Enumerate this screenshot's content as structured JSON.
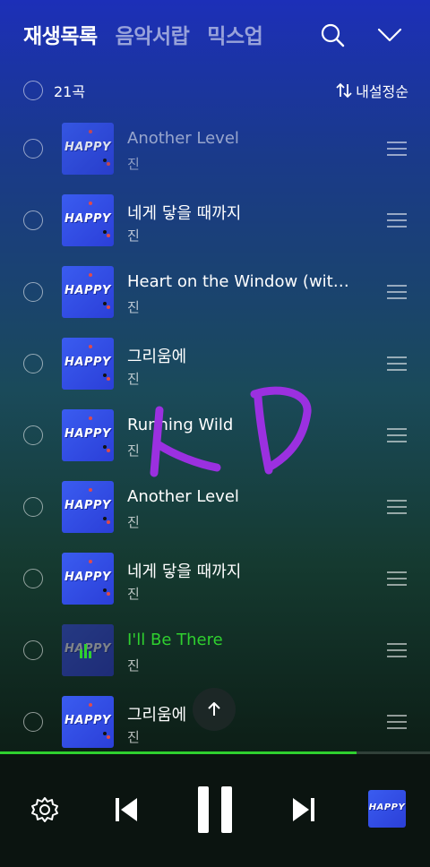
{
  "tabs": [
    {
      "label": "재생목록",
      "active": true
    },
    {
      "label": "음악서랍",
      "active": false
    },
    {
      "label": "믹스업",
      "active": false
    }
  ],
  "header_icons": [
    "search-icon",
    "chevron-down-icon"
  ],
  "list_header": {
    "count": "21곡",
    "sort_label": "내설정순"
  },
  "album_art_text": "HAPPY",
  "tracks": [
    {
      "title": "Another Level",
      "artist": "진",
      "state": "dim"
    },
    {
      "title": "네게 닿을 때까지",
      "artist": "진",
      "state": "normal"
    },
    {
      "title": "Heart on the Window (with ...",
      "artist": "진",
      "state": "normal"
    },
    {
      "title": "그리움에",
      "artist": "진",
      "state": "normal"
    },
    {
      "title": "Running Wild",
      "artist": "진",
      "state": "normal"
    },
    {
      "title": "Another Level",
      "artist": "진",
      "state": "normal"
    },
    {
      "title": "네게 닿을 때까지",
      "artist": "진",
      "state": "normal"
    },
    {
      "title": "I'll Be There",
      "artist": "진",
      "state": "playing"
    },
    {
      "title": "그리움에",
      "artist": "진",
      "state": "normal"
    }
  ],
  "progress": 0.83,
  "colors": {
    "accent": "#2fd02f",
    "annotation": "#9b30e0"
  },
  "player_icons": [
    "settings-icon",
    "previous-icon",
    "pause-icon",
    "next-icon",
    "album-thumb"
  ]
}
